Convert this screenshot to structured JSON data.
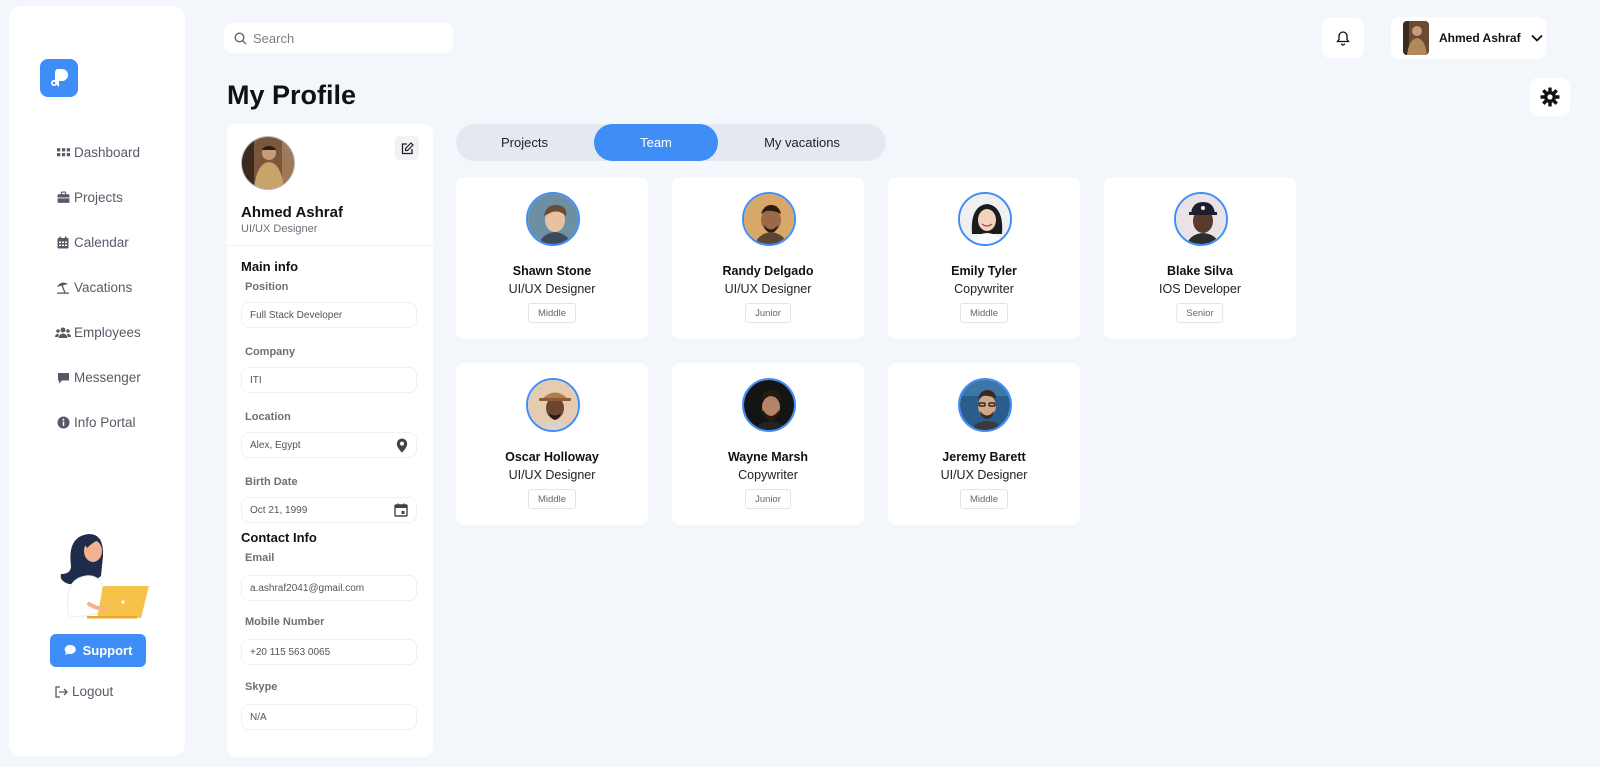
{
  "nav": {
    "items": [
      {
        "label": "Dashboard",
        "icon": "grid-icon"
      },
      {
        "label": "Projects",
        "icon": "briefcase-icon"
      },
      {
        "label": "Calendar",
        "icon": "calendar-icon"
      },
      {
        "label": "Vacations",
        "icon": "umbrella-beach-icon"
      },
      {
        "label": "Employees",
        "icon": "users-icon"
      },
      {
        "label": "Messenger",
        "icon": "chat-icon"
      },
      {
        "label": "Info Portal",
        "icon": "info-icon"
      }
    ],
    "support_label": "Support",
    "logout_label": "Logout"
  },
  "topbar": {
    "search_placeholder": "Search",
    "user_name": "Ahmed Ashraf"
  },
  "page": {
    "title": "My Profile"
  },
  "profile": {
    "name": "Ahmed Ashraf",
    "role": "UI/UX Designer",
    "main_info_title": "Main info",
    "contact_info_title": "Contact Info",
    "fields": {
      "position": {
        "label": "Position",
        "value": "Full Stack Developer"
      },
      "company": {
        "label": "Company",
        "value": "ITI"
      },
      "location": {
        "label": "Location",
        "value": "Alex, Egypt"
      },
      "birth_date": {
        "label": "Birth Date",
        "value": "Oct 21, 1999"
      },
      "email": {
        "label": "Email",
        "value": "a.ashraf2041@gmail.com"
      },
      "mobile": {
        "label": "Mobile Number",
        "value": "+20 115 563 0065"
      },
      "skype": {
        "label": "Skype",
        "value": "N/A"
      }
    }
  },
  "tabs": [
    {
      "label": "Projects",
      "active": false
    },
    {
      "label": "Team",
      "active": true
    },
    {
      "label": "My vacations",
      "active": false
    }
  ],
  "team": [
    {
      "name": "Shawn Stone",
      "role": "UI/UX Designer",
      "level": "Middle"
    },
    {
      "name": "Randy Delgado",
      "role": "UI/UX Designer",
      "level": "Junior"
    },
    {
      "name": "Emily Tyler",
      "role": "Copywriter",
      "level": "Middle"
    },
    {
      "name": "Blake Silva",
      "role": "IOS Developer",
      "level": "Senior"
    },
    {
      "name": "Oscar Holloway",
      "role": "UI/UX Designer",
      "level": "Middle"
    },
    {
      "name": "Wayne Marsh",
      "role": "Copywriter",
      "level": "Junior"
    },
    {
      "name": "Jeremy Barett",
      "role": "UI/UX Designer",
      "level": "Middle"
    }
  ],
  "colors": {
    "accent": "#3f8ef7",
    "background": "#f3f7fc"
  }
}
